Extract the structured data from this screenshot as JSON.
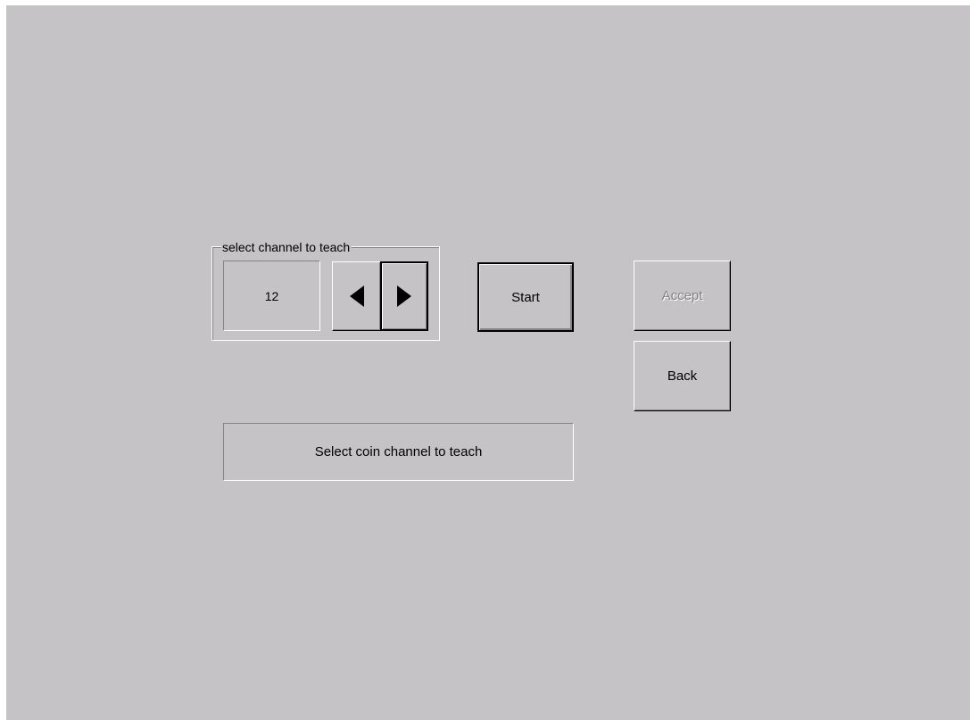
{
  "channel_group": {
    "legend": "select channel to teach",
    "channel_value": "12",
    "prev_icon": "left-arrow-icon",
    "next_icon": "right-arrow-icon"
  },
  "buttons": {
    "start_label": "Start",
    "accept_label": "Accept",
    "back_label": "Back"
  },
  "status": {
    "message": "Select coin channel to teach"
  },
  "colors": {
    "background": "#c6c3c6",
    "highlight": "#ffffff",
    "shadow": "#848284",
    "disabled_text": "#848284"
  }
}
